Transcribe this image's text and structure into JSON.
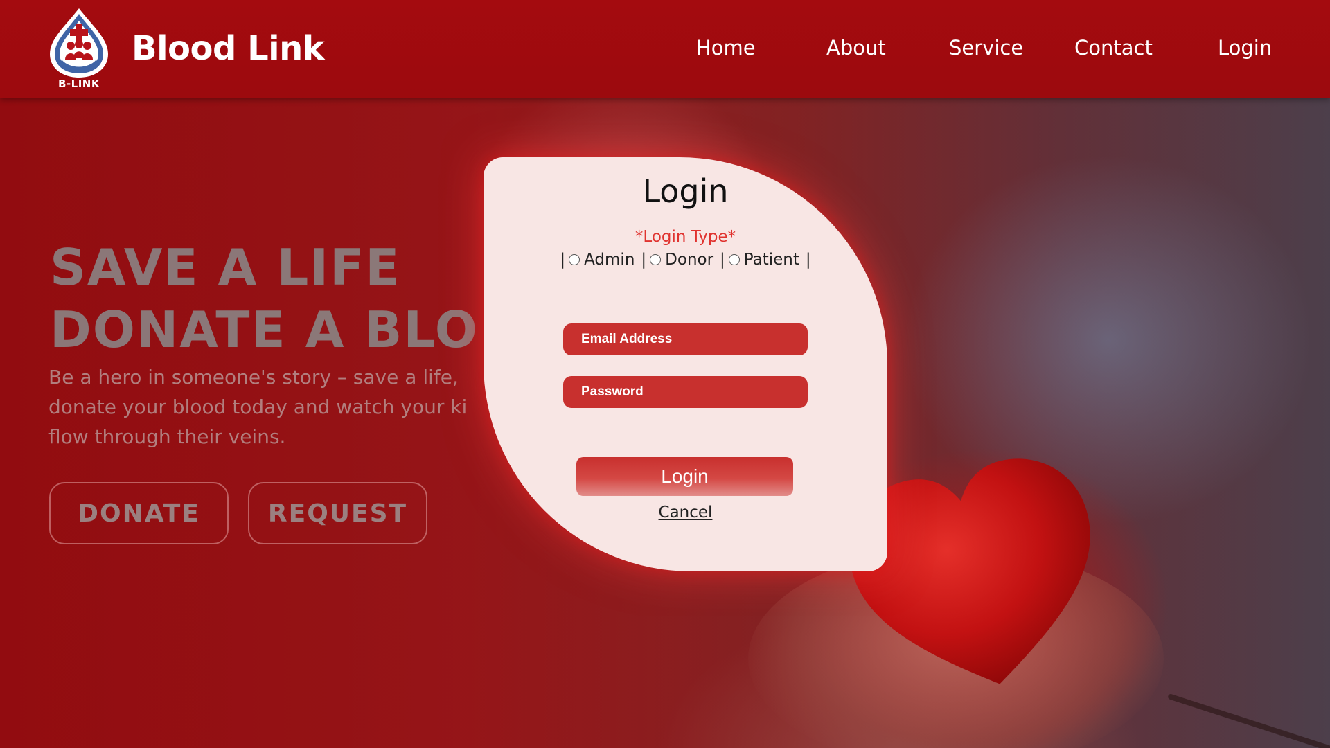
{
  "header": {
    "brand": "Blood Link",
    "logo_text": "B-LINK",
    "nav": {
      "home": "Home",
      "about": "About",
      "service": "Service",
      "contact": "Contact",
      "login": "Login"
    }
  },
  "hero": {
    "title_line1": "SAVE A LIFE",
    "title_line2": "DONATE A BLO",
    "text_line1": "Be a hero in someone's story – save a life,",
    "text_line2": "donate your blood today and watch your ki",
    "text_line3": "flow through their veins.",
    "donate_label": "DONATE",
    "request_label": "REQUEST"
  },
  "login_modal": {
    "title": "Login",
    "login_type_label": "*Login Type*",
    "options": {
      "admin": "Admin",
      "donor": "Donor",
      "patient": "Patient"
    },
    "separator": "|",
    "email_placeholder": "Email Address",
    "password_placeholder": "Password",
    "login_button": "Login",
    "cancel_link": "Cancel"
  },
  "colors": {
    "header_bg": "#a40b0f",
    "modal_bg": "#f8e6e4",
    "field_bg": "#c8302e",
    "login_type_color": "#e0332f"
  }
}
